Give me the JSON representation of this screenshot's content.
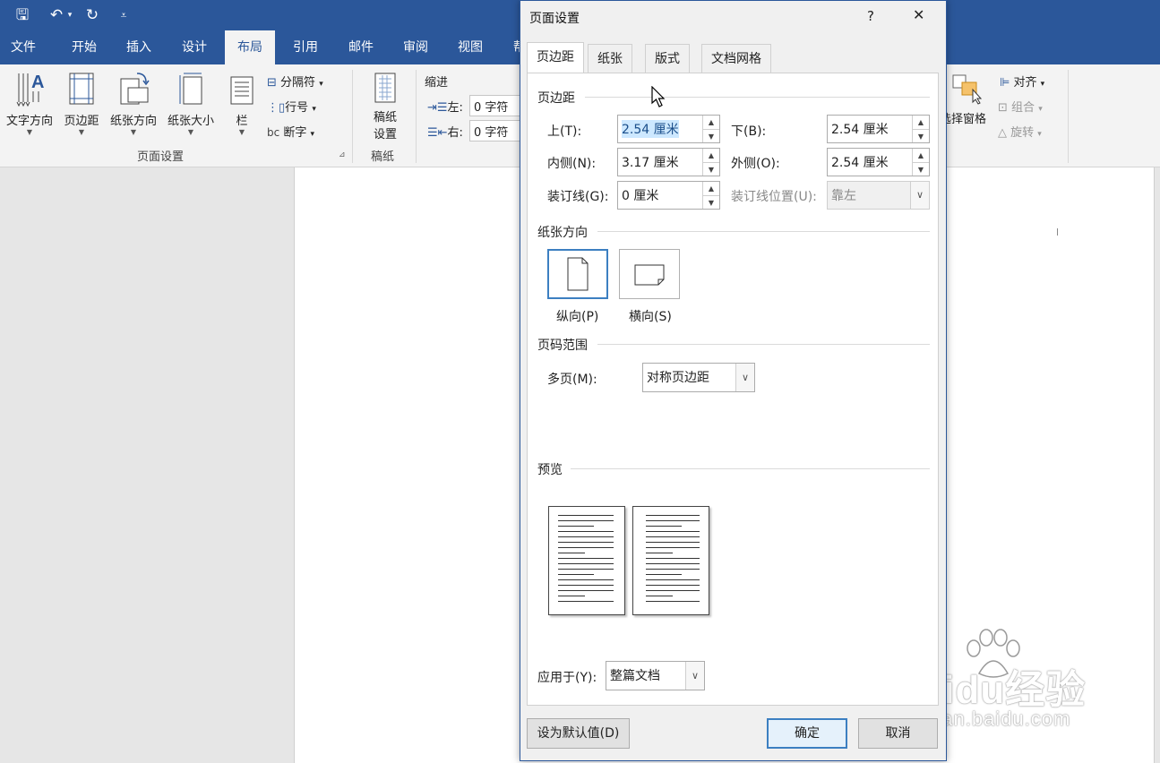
{
  "quick_access": {
    "save": "🖫",
    "undo": "↶",
    "redo": "↻",
    "customize": "⩡"
  },
  "ribbon_tabs": [
    "文件",
    "开始",
    "插入",
    "设计",
    "布局",
    "引用",
    "邮件",
    "审阅",
    "视图",
    "帮"
  ],
  "ribbon": {
    "page_setup": {
      "text_direction": "文字方向",
      "margins": "页边距",
      "orientation": "纸张方向",
      "size": "纸张大小",
      "columns": "栏",
      "breaks": "分隔符",
      "line_numbers": "行号",
      "hyphenation": "断字",
      "group_label": "页面设置"
    },
    "manuscript": {
      "button": "稿纸\n设置",
      "button_line1": "稿纸",
      "button_line2": "设置",
      "group_label": "稿纸"
    },
    "indent": {
      "title": "缩进",
      "left_label": "左:",
      "left_value": "0 字符",
      "right_label": "右:",
      "right_value": "0 字符"
    },
    "arrange": {
      "selection_pane": "选择窗格",
      "align": "对齐",
      "group": "组合",
      "rotate": "旋转"
    }
  },
  "dialog": {
    "title": "页面设置",
    "help": "?",
    "close": "✕",
    "tabs": [
      "页边距",
      "纸张",
      "版式",
      "文档网格"
    ],
    "margins_section": "页边距",
    "top_label": "上(T):",
    "top_value": "2.54 厘米",
    "bottom_label": "下(B):",
    "bottom_value": "2.54 厘米",
    "inside_label": "内侧(N):",
    "inside_value": "3.17 厘米",
    "outside_label": "外侧(O):",
    "outside_value": "2.54 厘米",
    "gutter_label": "装订线(G):",
    "gutter_value": "0 厘米",
    "gutter_pos_label": "装订线位置(U):",
    "gutter_pos_value": "靠左",
    "orientation_section": "纸张方向",
    "portrait": "纵向(P)",
    "landscape": "横向(S)",
    "pages_section": "页码范围",
    "multiple_pages_label": "多页(M):",
    "multiple_pages_value": "对称页边距",
    "preview_section": "预览",
    "apply_to_label": "应用于(Y):",
    "apply_to_value": "整篇文档",
    "set_default": "设为默认值(D)",
    "ok": "确定",
    "cancel": "取消"
  },
  "watermark": {
    "brand": "Baidu经验",
    "url": "jingyan.baidu.com"
  },
  "colors": {
    "ribbon_blue": "#2b579a",
    "selection": "#3c7fc1"
  }
}
